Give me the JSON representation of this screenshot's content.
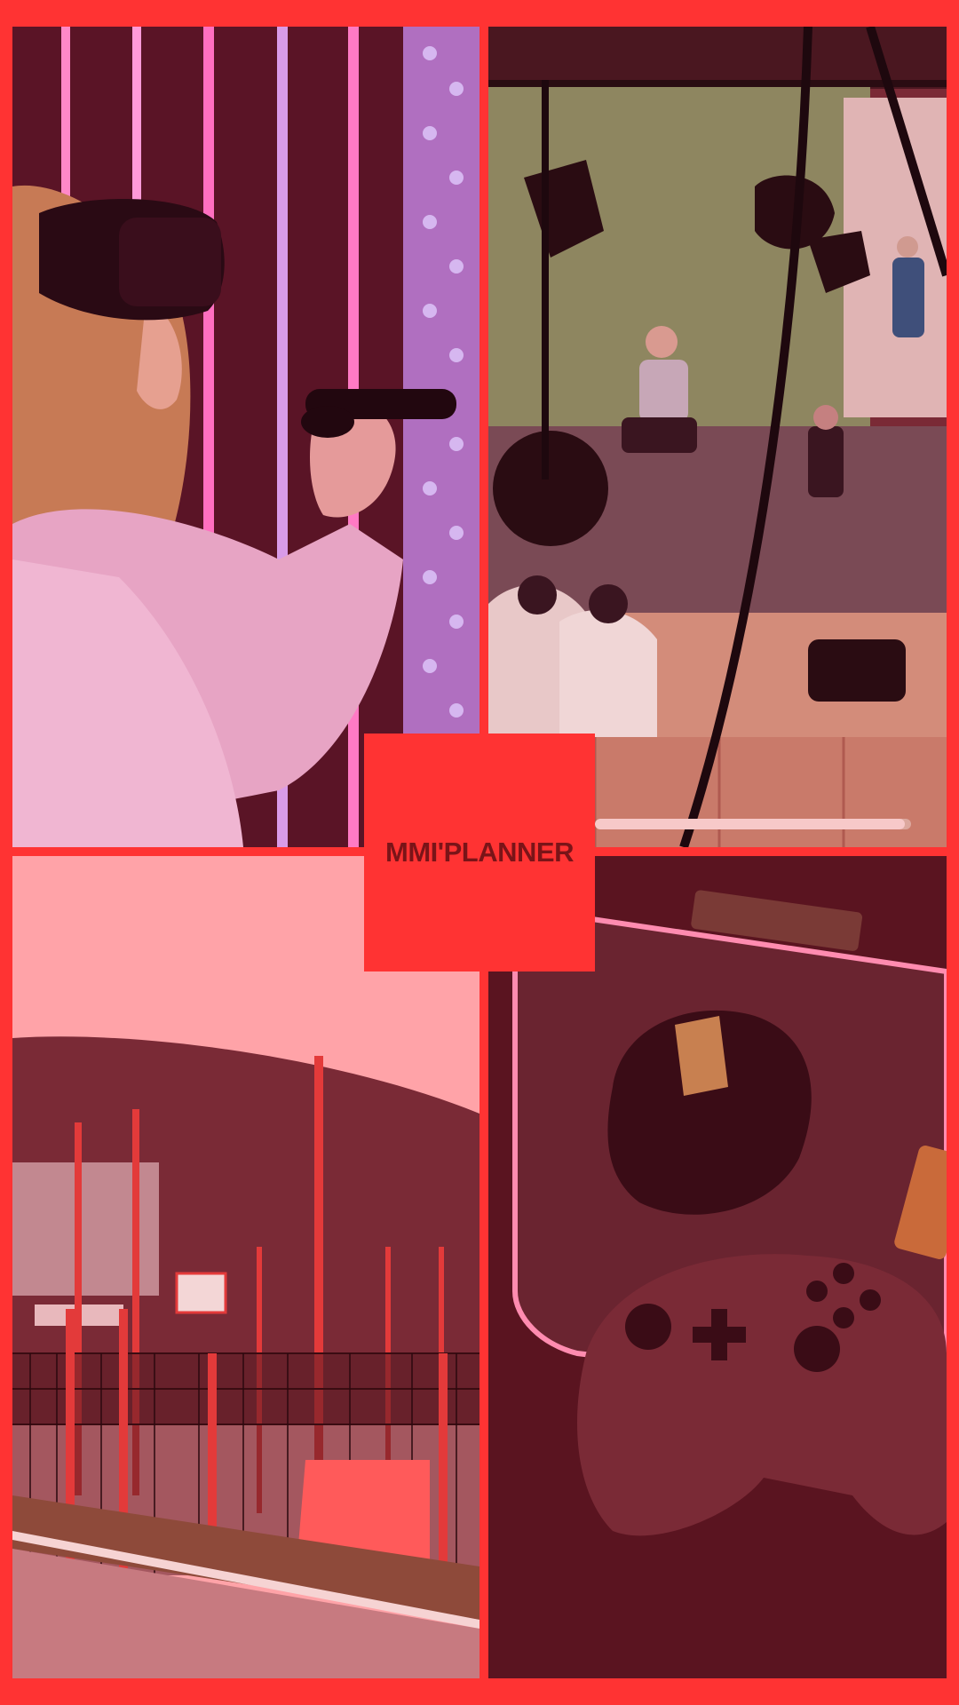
{
  "app": {
    "brand_name": "MMI'PLANNER"
  },
  "slideshow": {
    "progress": 0.98,
    "tiles": [
      {
        "subject": "vr-headset-student"
      },
      {
        "subject": "green-screen-studio"
      },
      {
        "subject": "outdoor-basketball-court"
      },
      {
        "subject": "gaming-mouse-and-controller"
      }
    ]
  },
  "colors": {
    "background": "#ff3333",
    "logo_text": "#7a1418",
    "overlay": "#ff4a55"
  }
}
